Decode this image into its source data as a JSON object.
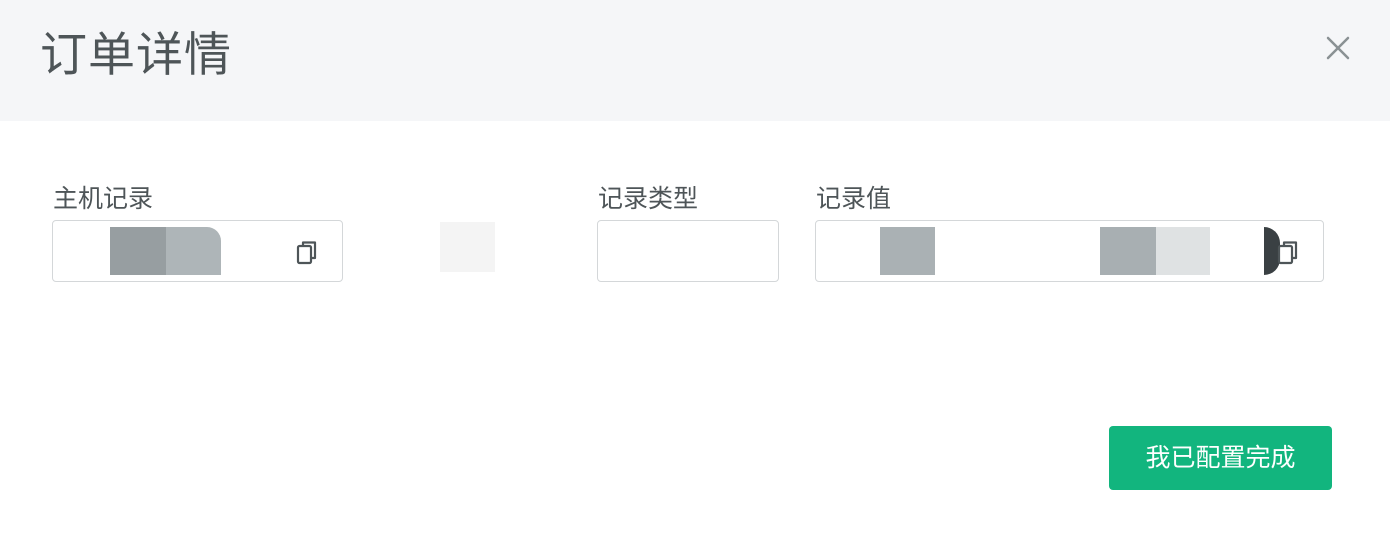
{
  "dialog": {
    "title": "订单详情",
    "close_icon": "close-icon"
  },
  "fields": {
    "host_record": {
      "label": "主机记录",
      "value": "████████",
      "copy_icon": "copy-icon"
    },
    "record_type": {
      "label": "记录类型",
      "value": ""
    },
    "record_value": {
      "label": "记录值",
      "value": "████████████████",
      "copy_icon": "copy-icon"
    }
  },
  "actions": {
    "confirm_label": "我已配置完成"
  },
  "colors": {
    "primary": "#12b57e",
    "header_bg": "#f5f6f8",
    "text": "#4e5558",
    "border": "#d4d7d9",
    "mask_dark": "#97a0a3",
    "mask_light": "#aeb5b8"
  }
}
